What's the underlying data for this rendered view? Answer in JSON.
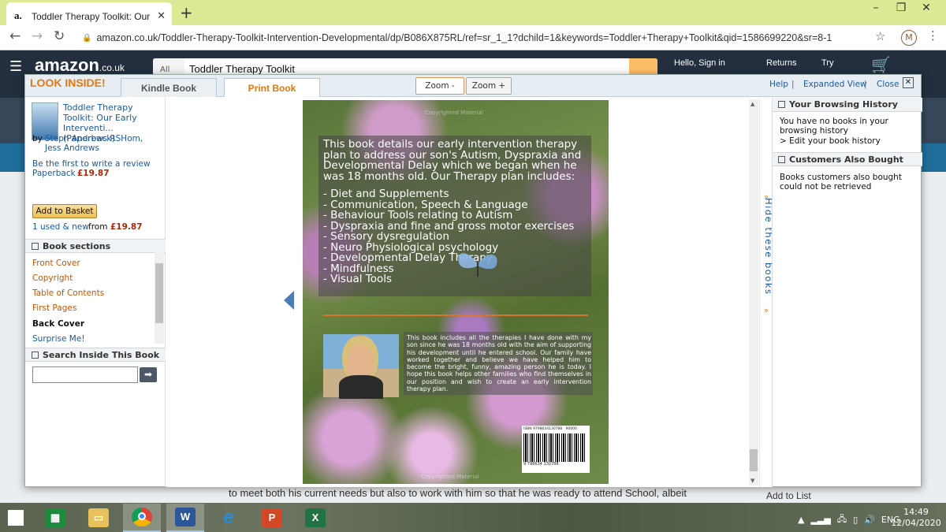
{
  "browser": {
    "tab_favicon": "a.",
    "tab_title": "Toddler Therapy Toolkit: Our Early",
    "url": "amazon.co.uk/Toddler-Therapy-Toolkit-Intervention-Developmental/dp/B086X875RL/ref=sr_1_1?dchild=1&keywords=Toddler+Therapy+Toolkit&qid=1586699220&sr=8-1",
    "profile_initial": "M"
  },
  "amazon": {
    "logo": "amazon",
    "logo_tld": ".co.uk",
    "search_category": "All",
    "search_query": "Toddler Therapy Toolkit",
    "hello": "Hello, Sign in",
    "returns": "Returns",
    "try": "Try",
    "behind_text": "to meet both his current needs but also to work with him so that he was ready to attend School, albeit",
    "add_to_list": "Add to List"
  },
  "modal": {
    "look_inside": "LOOK INSIDE!",
    "tabs": [
      {
        "label": "Kindle Book"
      },
      {
        "label": "Print Book"
      }
    ],
    "zoom_out": "Zoom -",
    "zoom_in": "Zoom +",
    "help": "Help",
    "expanded_view": "Expanded View",
    "close": "Close",
    "sep": "|"
  },
  "book": {
    "title": "Toddler Therapy Toolkit: Our Early Interventi... (Paperback)",
    "by": "by",
    "authors": "Steph Andrews RSHom, Jess Andrews",
    "review_link": "Be the first to write a review",
    "format": "Paperback",
    "price": "£19.87",
    "add_to_basket": "Add to Basket",
    "used_new": "1 used & new",
    "from": "from",
    "from_price": "£19.87"
  },
  "sections": {
    "header": "Book sections",
    "items": [
      {
        "label": "Front Cover"
      },
      {
        "label": "Copyright"
      },
      {
        "label": "Table of Contents"
      },
      {
        "label": "First Pages"
      },
      {
        "label": "Back Cover"
      },
      {
        "label": "Surprise Me!"
      }
    ]
  },
  "search_inside": {
    "header": "Search Inside This Book",
    "value": "",
    "go": "➡"
  },
  "cover": {
    "watermark_top": "Copyrighted Material",
    "watermark_bottom": "Copyrighted Material",
    "intro": "This book details our early intervention therapy plan to address our son's Autism, Dyspraxia and Developmental Delay which we began when he was 18 months old. Our Therapy plan includes:",
    "list": [
      "- Diet and Supplements",
      "- Communication, Speech & Language",
      "- Behaviour Tools relating to Autism",
      "- Dyspraxia and fine and gross motor exercises",
      "- Sensory dysregulation",
      "- Neuro Physiological psychology",
      "- Developmental Delay Therapy",
      "- Mindfulness",
      "- Visual Tools"
    ],
    "back_text": "This book includes all the therapies I have done with my son since he was 18 months old with the aim of supporting his development until he entered school. Our family have worked together and believe we have helped him to become the bright, funny, amazing person he is today. I hope this book helps other families who find themselves in our position and wish to create an early intervention therapy plan.",
    "isbn": "ISBN 9798634130788",
    "price_code": "90000",
    "barcode_num": "9 798634 130788"
  },
  "hide_books": "Hide these books",
  "browsing_history": {
    "header": "Your Browsing History",
    "text": "You have no books in your browsing history",
    "edit_link": "> Edit your book history"
  },
  "also_bought": {
    "header": "Customers Also Bought",
    "text": "Books customers also bought could not be retrieved"
  },
  "taskbar": {
    "lang": "ENG",
    "time": "14:49",
    "date": "12/04/2020",
    "apps": [
      {
        "icon": "calculator-icon"
      },
      {
        "icon": "file-explorer-icon"
      },
      {
        "icon": "chrome-icon"
      },
      {
        "icon": "word-icon",
        "glyph": "W"
      },
      {
        "icon": "internet-explorer-icon",
        "glyph": "e"
      },
      {
        "icon": "powerpoint-icon",
        "glyph": "P"
      },
      {
        "icon": "excel-icon",
        "glyph": "X"
      }
    ]
  },
  "colors": {
    "accent_orange": "#e47911",
    "link_blue": "#1a5aa0",
    "price_red": "#b12704",
    "tabbar": "#dcea96",
    "amazon_dark": "#232f3e"
  }
}
